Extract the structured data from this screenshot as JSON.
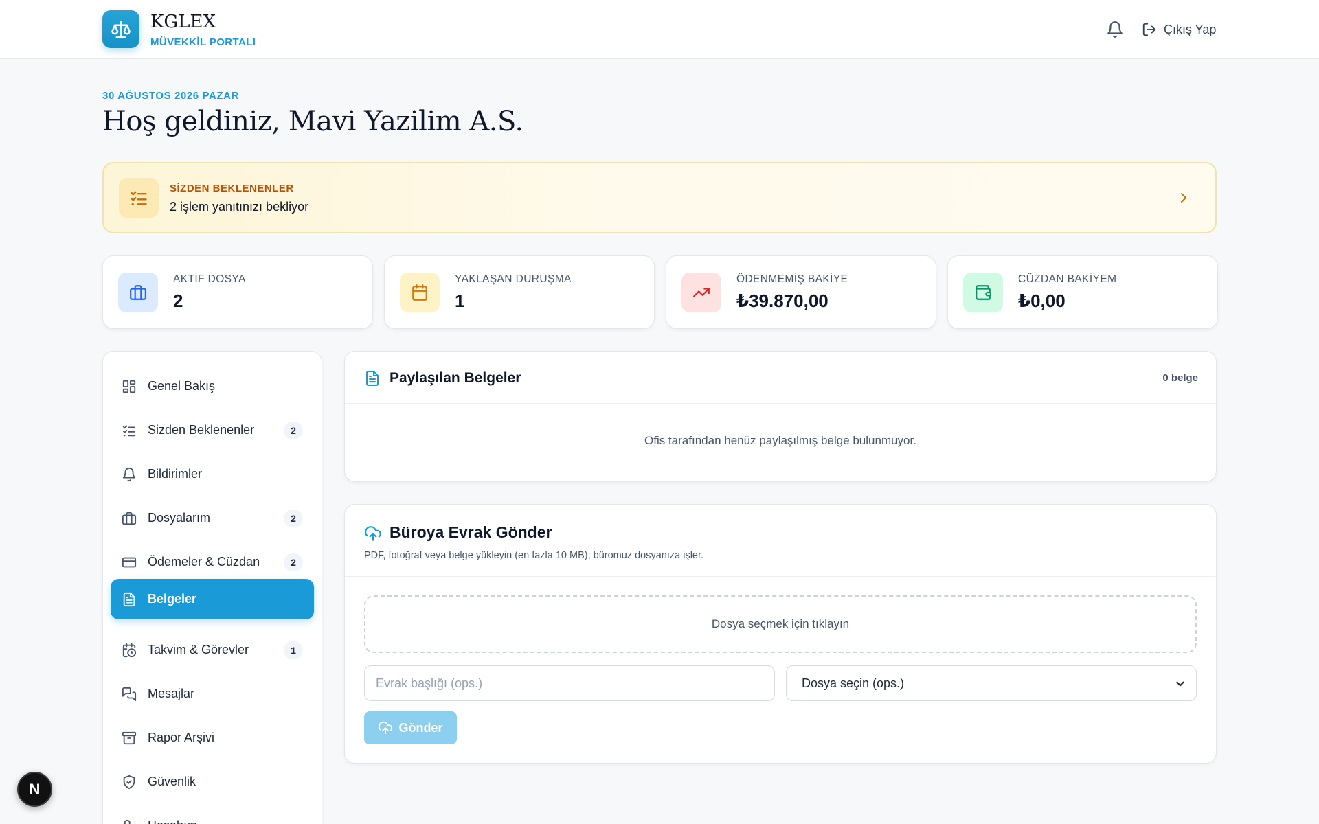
{
  "header": {
    "brand_name": "KGLEX",
    "brand_sub": "MÜVEKKİL PORTALI",
    "logout_label": "Çıkış Yap"
  },
  "welcome": {
    "date": "30 AĞUSTOS 2026 PAZAR",
    "title": "Hoş geldiniz, Mavi Yazilim A.S."
  },
  "pending": {
    "label": "SİZDEN BEKLENENLER",
    "text": "2 işlem yanıtınızı bekliyor"
  },
  "stats": [
    {
      "label": "AKTİF DOSYA",
      "value": "2",
      "icon": "briefcase-icon",
      "color": "#2563eb",
      "bg": "#dbeafe"
    },
    {
      "label": "YAKLAŞAN DURUŞMA",
      "value": "1",
      "icon": "calendar-icon",
      "color": "#d97706",
      "bg": "#fef3c7"
    },
    {
      "label": "ÖDENMEMİŞ BAKİYE",
      "value": "₺39.870,00",
      "icon": "trending-up-icon",
      "color": "#dc2626",
      "bg": "#fee2e2"
    },
    {
      "label": "CÜZDAN BAKİYEM",
      "value": "₺0,00",
      "icon": "wallet-icon",
      "color": "#059669",
      "bg": "#d1fae5"
    }
  ],
  "sidebar": {
    "items": [
      {
        "label": "Genel Bakış",
        "icon": "dashboard-icon"
      },
      {
        "label": "Sizden Beklenenler",
        "icon": "checklist-icon",
        "badge": "2"
      },
      {
        "label": "Bildirimler",
        "icon": "bell-icon"
      },
      {
        "label": "Dosyalarım",
        "icon": "briefcase-icon",
        "badge": "2"
      },
      {
        "label": "Ödemeler & Cüzdan",
        "icon": "credit-card-icon",
        "badge": "2"
      },
      {
        "label": "Belgeler",
        "icon": "document-icon",
        "active": true
      },
      {
        "label": "Takvim & Görevler",
        "icon": "calendar-clock-icon",
        "badge": "1"
      },
      {
        "label": "Mesajlar",
        "icon": "messages-icon"
      },
      {
        "label": "Rapor Arşivi",
        "icon": "archive-icon"
      },
      {
        "label": "Güvenlik",
        "icon": "shield-icon"
      },
      {
        "label": "Hesabım",
        "icon": "user-cog-icon"
      }
    ]
  },
  "shared_docs": {
    "title": "Paylaşılan Belgeler",
    "count": "0 belge",
    "empty_text": "Ofis tarafından henüz paylaşılmış belge bulunmuyor."
  },
  "upload": {
    "title": "Büroya Evrak Gönder",
    "subtitle": "PDF, fotoğraf veya belge yükleyin (en fazla 10 MB); büromuz dosyanıza işler.",
    "dropzone_text": "Dosya seçmek için tıklayın",
    "title_placeholder": "Evrak başlığı (ops.)",
    "file_select_value": "Dosya seçin (ops.)",
    "send_label": "Gönder"
  },
  "fab": {
    "label": "N"
  },
  "colors": {
    "accent": "#1a9ad6",
    "warning": "#b4530a",
    "background": "#f7f8fa"
  }
}
